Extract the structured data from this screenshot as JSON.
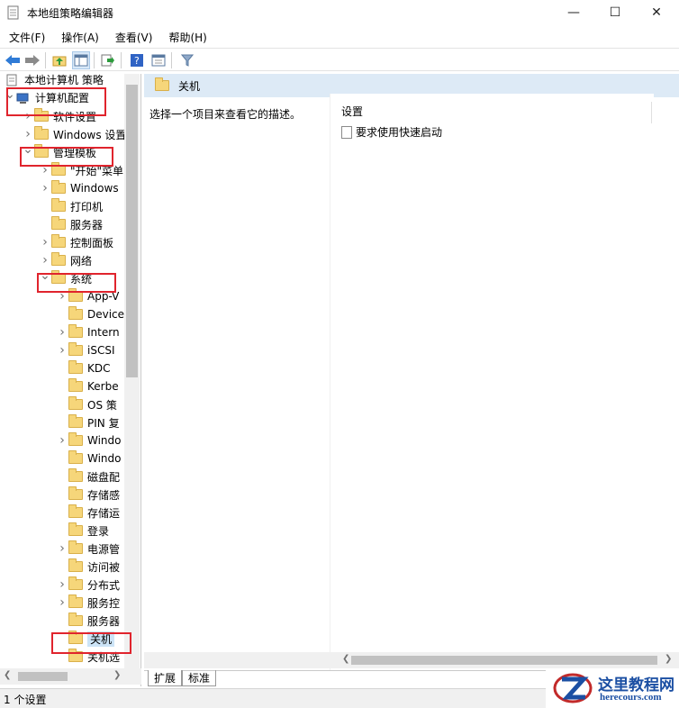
{
  "window": {
    "title": "本地组策略编辑器",
    "controls": {
      "minimize": "—",
      "maximize": "☐",
      "close": "✕"
    }
  },
  "menu": [
    "文件(F)",
    "操作(A)",
    "查看(V)",
    "帮助(H)"
  ],
  "tree": {
    "items": [
      {
        "label": "本地计算机 策略",
        "icon": "policy-icon"
      },
      {
        "label": "计算机配置",
        "icon": "computer-icon",
        "expanded": true
      },
      {
        "label": "软件设置",
        "icon": "folder-icon"
      },
      {
        "label": "Windows 设置",
        "icon": "folder-icon"
      },
      {
        "label": "管理模板",
        "icon": "folder-icon",
        "expanded": true
      },
      {
        "label": "\"开始\"菜单",
        "icon": "folder-icon"
      },
      {
        "label": "Windows",
        "icon": "folder-icon"
      },
      {
        "label": "打印机",
        "icon": "folder-icon"
      },
      {
        "label": "服务器",
        "icon": "folder-icon"
      },
      {
        "label": "控制面板",
        "icon": "folder-icon"
      },
      {
        "label": "网络",
        "icon": "folder-icon"
      },
      {
        "label": "系统",
        "icon": "folder-icon",
        "expanded": true
      },
      {
        "label": "App-V",
        "icon": "folder-icon"
      },
      {
        "label": "Device",
        "icon": "folder-icon"
      },
      {
        "label": "Intern",
        "icon": "folder-icon"
      },
      {
        "label": "iSCSI",
        "icon": "folder-icon"
      },
      {
        "label": "KDC",
        "icon": "folder-icon"
      },
      {
        "label": "Kerbe",
        "icon": "folder-icon"
      },
      {
        "label": "OS 策",
        "icon": "folder-icon"
      },
      {
        "label": "PIN 复",
        "icon": "folder-icon"
      },
      {
        "label": "Windo",
        "icon": "folder-icon"
      },
      {
        "label": "Windo",
        "icon": "folder-icon"
      },
      {
        "label": "磁盘配",
        "icon": "folder-icon"
      },
      {
        "label": "存储感",
        "icon": "folder-icon"
      },
      {
        "label": "存储运",
        "icon": "folder-icon"
      },
      {
        "label": "登录",
        "icon": "folder-icon"
      },
      {
        "label": "电源管",
        "icon": "folder-icon"
      },
      {
        "label": "访问被",
        "icon": "folder-icon"
      },
      {
        "label": "分布式",
        "icon": "folder-icon"
      },
      {
        "label": "服务控",
        "icon": "folder-icon"
      },
      {
        "label": "服务器",
        "icon": "folder-icon"
      },
      {
        "label": "关机",
        "icon": "folder-icon",
        "selected": true
      },
      {
        "label": "关机选",
        "icon": "folder-icon"
      }
    ]
  },
  "right": {
    "header": "关机",
    "description": "选择一个项目来查看它的描述。",
    "column_header": "设置",
    "settings": [
      "要求使用快速启动"
    ]
  },
  "tabs": [
    "扩展",
    "标准"
  ],
  "status": "1 个设置",
  "watermark": {
    "line1": "这里教程网",
    "line2": "herecours.com"
  },
  "colors": {
    "highlight_box": "#e0242d",
    "header_bg": "#ddeaf6",
    "folder": "#f6d67a"
  }
}
